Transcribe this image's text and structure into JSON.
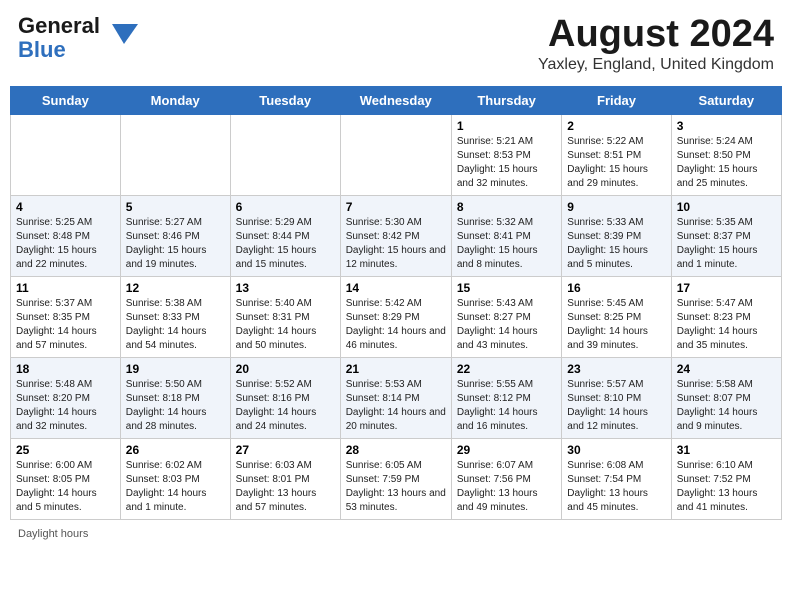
{
  "header": {
    "logo_general": "General",
    "logo_blue": "Blue",
    "month_title": "August 2024",
    "location": "Yaxley, England, United Kingdom"
  },
  "days_of_week": [
    "Sunday",
    "Monday",
    "Tuesday",
    "Wednesday",
    "Thursday",
    "Friday",
    "Saturday"
  ],
  "footer": {
    "daylight_label": "Daylight hours"
  },
  "weeks": [
    [
      {
        "day": "",
        "sunrise": "",
        "sunset": "",
        "daylight": ""
      },
      {
        "day": "",
        "sunrise": "",
        "sunset": "",
        "daylight": ""
      },
      {
        "day": "",
        "sunrise": "",
        "sunset": "",
        "daylight": ""
      },
      {
        "day": "",
        "sunrise": "",
        "sunset": "",
        "daylight": ""
      },
      {
        "day": "1",
        "sunrise": "Sunrise: 5:21 AM",
        "sunset": "Sunset: 8:53 PM",
        "daylight": "Daylight: 15 hours and 32 minutes."
      },
      {
        "day": "2",
        "sunrise": "Sunrise: 5:22 AM",
        "sunset": "Sunset: 8:51 PM",
        "daylight": "Daylight: 15 hours and 29 minutes."
      },
      {
        "day": "3",
        "sunrise": "Sunrise: 5:24 AM",
        "sunset": "Sunset: 8:50 PM",
        "daylight": "Daylight: 15 hours and 25 minutes."
      }
    ],
    [
      {
        "day": "4",
        "sunrise": "Sunrise: 5:25 AM",
        "sunset": "Sunset: 8:48 PM",
        "daylight": "Daylight: 15 hours and 22 minutes."
      },
      {
        "day": "5",
        "sunrise": "Sunrise: 5:27 AM",
        "sunset": "Sunset: 8:46 PM",
        "daylight": "Daylight: 15 hours and 19 minutes."
      },
      {
        "day": "6",
        "sunrise": "Sunrise: 5:29 AM",
        "sunset": "Sunset: 8:44 PM",
        "daylight": "Daylight: 15 hours and 15 minutes."
      },
      {
        "day": "7",
        "sunrise": "Sunrise: 5:30 AM",
        "sunset": "Sunset: 8:42 PM",
        "daylight": "Daylight: 15 hours and 12 minutes."
      },
      {
        "day": "8",
        "sunrise": "Sunrise: 5:32 AM",
        "sunset": "Sunset: 8:41 PM",
        "daylight": "Daylight: 15 hours and 8 minutes."
      },
      {
        "day": "9",
        "sunrise": "Sunrise: 5:33 AM",
        "sunset": "Sunset: 8:39 PM",
        "daylight": "Daylight: 15 hours and 5 minutes."
      },
      {
        "day": "10",
        "sunrise": "Sunrise: 5:35 AM",
        "sunset": "Sunset: 8:37 PM",
        "daylight": "Daylight: 15 hours and 1 minute."
      }
    ],
    [
      {
        "day": "11",
        "sunrise": "Sunrise: 5:37 AM",
        "sunset": "Sunset: 8:35 PM",
        "daylight": "Daylight: 14 hours and 57 minutes."
      },
      {
        "day": "12",
        "sunrise": "Sunrise: 5:38 AM",
        "sunset": "Sunset: 8:33 PM",
        "daylight": "Daylight: 14 hours and 54 minutes."
      },
      {
        "day": "13",
        "sunrise": "Sunrise: 5:40 AM",
        "sunset": "Sunset: 8:31 PM",
        "daylight": "Daylight: 14 hours and 50 minutes."
      },
      {
        "day": "14",
        "sunrise": "Sunrise: 5:42 AM",
        "sunset": "Sunset: 8:29 PM",
        "daylight": "Daylight: 14 hours and 46 minutes."
      },
      {
        "day": "15",
        "sunrise": "Sunrise: 5:43 AM",
        "sunset": "Sunset: 8:27 PM",
        "daylight": "Daylight: 14 hours and 43 minutes."
      },
      {
        "day": "16",
        "sunrise": "Sunrise: 5:45 AM",
        "sunset": "Sunset: 8:25 PM",
        "daylight": "Daylight: 14 hours and 39 minutes."
      },
      {
        "day": "17",
        "sunrise": "Sunrise: 5:47 AM",
        "sunset": "Sunset: 8:23 PM",
        "daylight": "Daylight: 14 hours and 35 minutes."
      }
    ],
    [
      {
        "day": "18",
        "sunrise": "Sunrise: 5:48 AM",
        "sunset": "Sunset: 8:20 PM",
        "daylight": "Daylight: 14 hours and 32 minutes."
      },
      {
        "day": "19",
        "sunrise": "Sunrise: 5:50 AM",
        "sunset": "Sunset: 8:18 PM",
        "daylight": "Daylight: 14 hours and 28 minutes."
      },
      {
        "day": "20",
        "sunrise": "Sunrise: 5:52 AM",
        "sunset": "Sunset: 8:16 PM",
        "daylight": "Daylight: 14 hours and 24 minutes."
      },
      {
        "day": "21",
        "sunrise": "Sunrise: 5:53 AM",
        "sunset": "Sunset: 8:14 PM",
        "daylight": "Daylight: 14 hours and 20 minutes."
      },
      {
        "day": "22",
        "sunrise": "Sunrise: 5:55 AM",
        "sunset": "Sunset: 8:12 PM",
        "daylight": "Daylight: 14 hours and 16 minutes."
      },
      {
        "day": "23",
        "sunrise": "Sunrise: 5:57 AM",
        "sunset": "Sunset: 8:10 PM",
        "daylight": "Daylight: 14 hours and 12 minutes."
      },
      {
        "day": "24",
        "sunrise": "Sunrise: 5:58 AM",
        "sunset": "Sunset: 8:07 PM",
        "daylight": "Daylight: 14 hours and 9 minutes."
      }
    ],
    [
      {
        "day": "25",
        "sunrise": "Sunrise: 6:00 AM",
        "sunset": "Sunset: 8:05 PM",
        "daylight": "Daylight: 14 hours and 5 minutes."
      },
      {
        "day": "26",
        "sunrise": "Sunrise: 6:02 AM",
        "sunset": "Sunset: 8:03 PM",
        "daylight": "Daylight: 14 hours and 1 minute."
      },
      {
        "day": "27",
        "sunrise": "Sunrise: 6:03 AM",
        "sunset": "Sunset: 8:01 PM",
        "daylight": "Daylight: 13 hours and 57 minutes."
      },
      {
        "day": "28",
        "sunrise": "Sunrise: 6:05 AM",
        "sunset": "Sunset: 7:59 PM",
        "daylight": "Daylight: 13 hours and 53 minutes."
      },
      {
        "day": "29",
        "sunrise": "Sunrise: 6:07 AM",
        "sunset": "Sunset: 7:56 PM",
        "daylight": "Daylight: 13 hours and 49 minutes."
      },
      {
        "day": "30",
        "sunrise": "Sunrise: 6:08 AM",
        "sunset": "Sunset: 7:54 PM",
        "daylight": "Daylight: 13 hours and 45 minutes."
      },
      {
        "day": "31",
        "sunrise": "Sunrise: 6:10 AM",
        "sunset": "Sunset: 7:52 PM",
        "daylight": "Daylight: 13 hours and 41 minutes."
      }
    ]
  ]
}
